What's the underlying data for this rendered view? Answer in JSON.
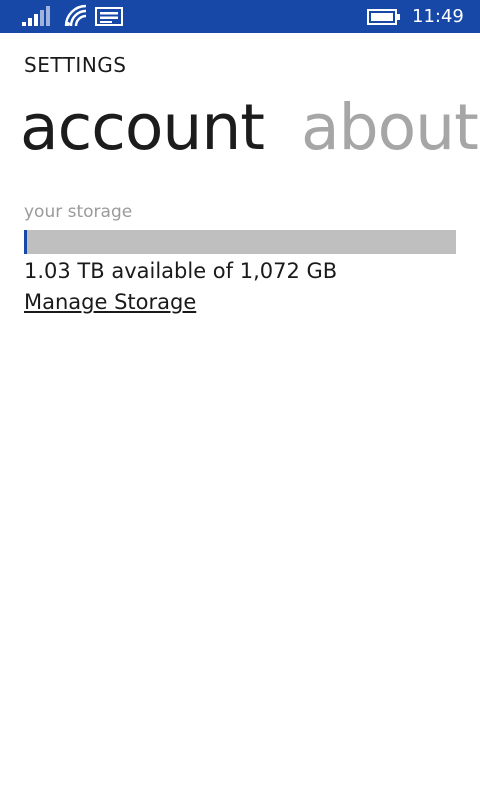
{
  "status_bar": {
    "time": "11:49",
    "background": "#1748a8",
    "icons": [
      "signal-icon",
      "wifi-icon",
      "message-icon",
      "battery-icon"
    ]
  },
  "app": {
    "title": "SETTINGS"
  },
  "pivot": {
    "items": [
      {
        "label": "account",
        "active": true
      },
      {
        "label": "about",
        "active": false
      }
    ]
  },
  "storage": {
    "label": "your storage",
    "used_fraction": 0.008,
    "summary": "1.03 TB available of 1,072 GB",
    "manage_link": "Manage Storage",
    "bar_color": "#1748a8",
    "track_color": "#bfbfbf"
  }
}
